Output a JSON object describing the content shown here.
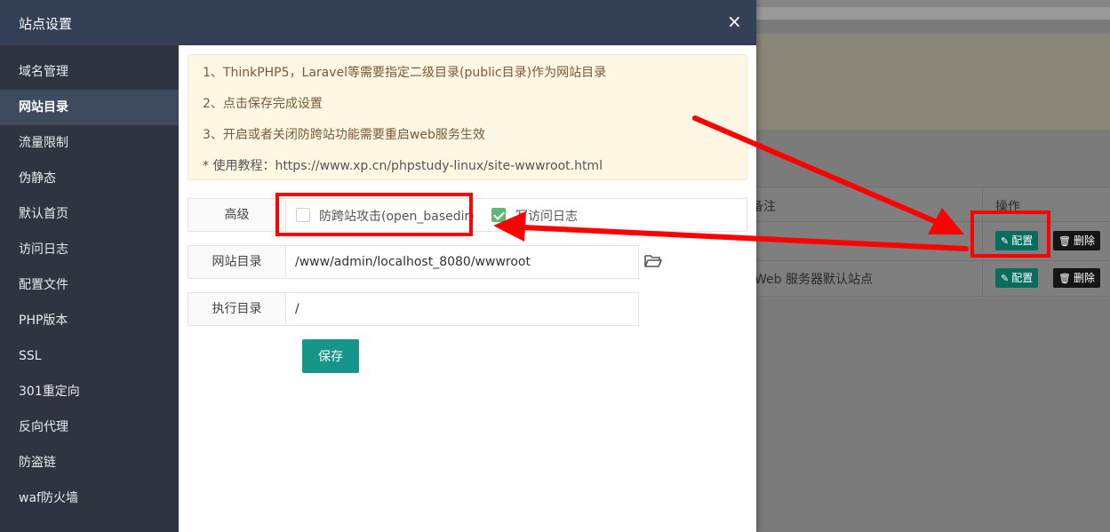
{
  "modal": {
    "title": "站点设置",
    "close_symbol": "×"
  },
  "sidebar": {
    "items": [
      {
        "label": "域名管理"
      },
      {
        "label": "网站目录"
      },
      {
        "label": "流量限制"
      },
      {
        "label": "伪静态"
      },
      {
        "label": "默认首页"
      },
      {
        "label": "访问日志"
      },
      {
        "label": "配置文件"
      },
      {
        "label": "PHP版本"
      },
      {
        "label": "SSL"
      },
      {
        "label": "301重定向"
      },
      {
        "label": "反向代理"
      },
      {
        "label": "防盗链"
      },
      {
        "label": "waf防火墙"
      }
    ],
    "active": "网站目录"
  },
  "notice": {
    "line1": "1、ThinkPHP5，Laravel等需要指定二级目录(public目录)作为网站目录",
    "line2": "2、点击保存完成设置",
    "line3": "3、开启或者关闭防跨站功能需要重启web服务生效",
    "tutorial": "* 使用教程：https://www.xp.cn/phpstudy-linux/site-wwwroot.html"
  },
  "form": {
    "advanced_label": "高级",
    "anti_cross_site_label": "防跨站攻击(open_basedir)",
    "anti_cross_site_checked": false,
    "access_log_label": "写访问日志",
    "access_log_checked": true,
    "site_dir_label": "网站目录",
    "site_dir_value": "/www/admin/localhost_8080/wwwroot",
    "exec_dir_label": "执行目录",
    "exec_dir_value": "/",
    "save_label": "保存"
  },
  "background_table": {
    "col_note": "备注",
    "col_action": "操作",
    "rows": [
      {
        "note": "",
        "config_label": "配置",
        "delete_label": "删除"
      },
      {
        "note": "Web 服务器默认站点",
        "config_label": "配置",
        "delete_label": "删除"
      }
    ]
  },
  "colors": {
    "header_bg": "#344056",
    "sidebar_bg": "#2f3440",
    "sidebar_active": "#3e4b5f",
    "save_button": "#16968a",
    "checkbox_on": "#5fb878",
    "annotation_red": "#ff0000"
  },
  "icons": {
    "folder": "folder-open-icon",
    "pencil": "pencil-icon",
    "trash": "trash-icon",
    "close": "close-icon",
    "check": "check-icon"
  }
}
